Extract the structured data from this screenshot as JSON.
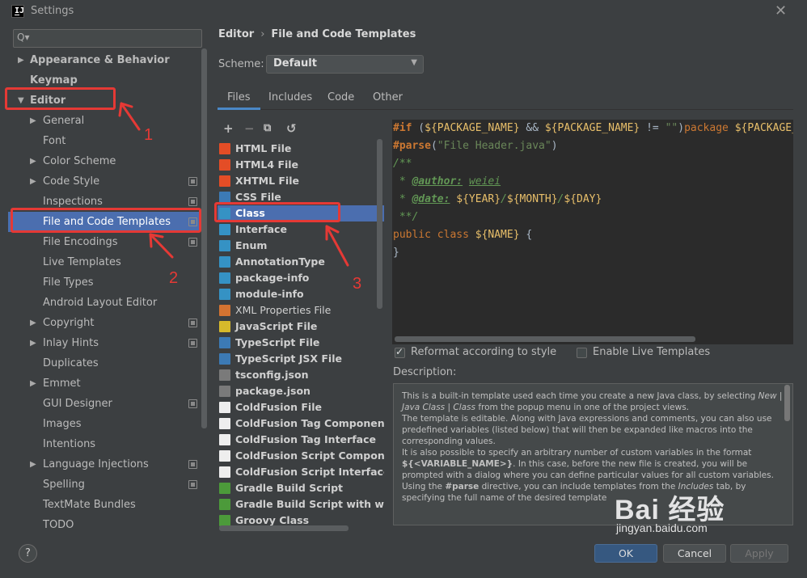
{
  "window": {
    "title": "Settings"
  },
  "search": {
    "placeholder": "Q▾"
  },
  "tree": [
    {
      "label": "Appearance & Behavior",
      "level": 0,
      "expanded": false,
      "bold": true
    },
    {
      "label": "Keymap",
      "level": 0,
      "bold": true
    },
    {
      "label": "Editor",
      "level": 0,
      "expanded": true,
      "bold": true
    },
    {
      "label": "General",
      "level": 1,
      "arrow": true
    },
    {
      "label": "Font",
      "level": 1
    },
    {
      "label": "Color Scheme",
      "level": 1,
      "arrow": true
    },
    {
      "label": "Code Style",
      "level": 1,
      "arrow": true,
      "badge": true
    },
    {
      "label": "Inspections",
      "level": 1,
      "badge": true
    },
    {
      "label": "File and Code Templates",
      "level": 1,
      "badge": true,
      "selected": true
    },
    {
      "label": "File Encodings",
      "level": 1,
      "badge": true
    },
    {
      "label": "Live Templates",
      "level": 1
    },
    {
      "label": "File Types",
      "level": 1
    },
    {
      "label": "Android Layout Editor",
      "level": 1
    },
    {
      "label": "Copyright",
      "level": 1,
      "arrow": true,
      "badge": true
    },
    {
      "label": "Inlay Hints",
      "level": 1,
      "arrow": true,
      "badge": true
    },
    {
      "label": "Duplicates",
      "level": 1
    },
    {
      "label": "Emmet",
      "level": 1,
      "arrow": true
    },
    {
      "label": "GUI Designer",
      "level": 1,
      "badge": true
    },
    {
      "label": "Images",
      "level": 1
    },
    {
      "label": "Intentions",
      "level": 1
    },
    {
      "label": "Language Injections",
      "level": 1,
      "arrow": true,
      "badge": true
    },
    {
      "label": "Spelling",
      "level": 1,
      "badge": true
    },
    {
      "label": "TextMate Bundles",
      "level": 1
    },
    {
      "label": "TODO",
      "level": 1
    }
  ],
  "annotations": {
    "n1": "1",
    "n2": "2",
    "n3": "3"
  },
  "breadcrumb": {
    "parent": "Editor",
    "sep": "›",
    "current": "File and Code Templates"
  },
  "scheme": {
    "label": "Scheme:",
    "value": "Default"
  },
  "tabs": [
    {
      "label": "Files",
      "active": true
    },
    {
      "label": "Includes"
    },
    {
      "label": "Code"
    },
    {
      "label": "Other"
    }
  ],
  "toolbar": {
    "add": "+",
    "remove": "−",
    "copy": "⧉",
    "reset": "↺"
  },
  "files": [
    {
      "label": "HTML File",
      "icon": "html-file-icon",
      "color": "#e44d26",
      "bold": true
    },
    {
      "label": "HTML4 File",
      "icon": "html-file-icon",
      "color": "#e44d26",
      "bold": true
    },
    {
      "label": "XHTML File",
      "icon": "html-file-icon",
      "color": "#e44d26",
      "bold": true
    },
    {
      "label": "CSS File",
      "icon": "css-file-icon",
      "color": "#3c7ab5",
      "bold": true
    },
    {
      "label": "Class",
      "icon": "java-class-icon",
      "color": "#3592c4",
      "bold": true,
      "selected": true
    },
    {
      "label": "Interface",
      "icon": "java-interface-icon",
      "color": "#3592c4",
      "bold": true
    },
    {
      "label": "Enum",
      "icon": "java-enum-icon",
      "color": "#3592c4",
      "bold": true
    },
    {
      "label": "AnnotationType",
      "icon": "java-annotation-icon",
      "color": "#3592c4",
      "bold": true
    },
    {
      "label": "package-info",
      "icon": "java-file-icon",
      "color": "#3592c4",
      "bold": true
    },
    {
      "label": "module-info",
      "icon": "java-file-icon",
      "color": "#3592c4",
      "bold": true
    },
    {
      "label": "XML Properties File",
      "icon": "xml-file-icon",
      "color": "#d47331",
      "bold": false
    },
    {
      "label": "JavaScript File",
      "icon": "javascript-file-icon",
      "color": "#d7ba2b",
      "bold": true
    },
    {
      "label": "TypeScript File",
      "icon": "typescript-file-icon",
      "color": "#3c7ab5",
      "bold": true
    },
    {
      "label": "TypeScript JSX File",
      "icon": "typescript-file-icon",
      "color": "#3c7ab5",
      "bold": true
    },
    {
      "label": "tsconfig.json",
      "icon": "json-file-icon",
      "color": "#7a7a7a",
      "bold": true
    },
    {
      "label": "package.json",
      "icon": "json-file-icon",
      "color": "#7a7a7a",
      "bold": true
    },
    {
      "label": "ColdFusion File",
      "icon": "coldfusion-file-icon",
      "color": "#eeeeee",
      "bold": true
    },
    {
      "label": "ColdFusion Tag Component",
      "icon": "coldfusion-file-icon",
      "color": "#eeeeee",
      "bold": true
    },
    {
      "label": "ColdFusion Tag Interface",
      "icon": "coldfusion-file-icon",
      "color": "#eeeeee",
      "bold": true
    },
    {
      "label": "ColdFusion Script Component",
      "icon": "coldfusion-file-icon",
      "color": "#eeeeee",
      "bold": true
    },
    {
      "label": "ColdFusion Script Interface",
      "icon": "coldfusion-file-icon",
      "color": "#eeeeee",
      "bold": true
    },
    {
      "label": "Gradle Build Script",
      "icon": "gradle-icon",
      "color": "#4c9a3a",
      "bold": true
    },
    {
      "label": "Gradle Build Script with wrapp",
      "icon": "gradle-icon",
      "color": "#4c9a3a",
      "bold": true
    },
    {
      "label": "Groovy Class",
      "icon": "groovy-icon",
      "color": "#4c9a3a",
      "bold": true
    }
  ],
  "code": {
    "line1": {
      "if": "#if",
      "p1": " (",
      "v1": "${PACKAGE_NAME}",
      "and": " && ",
      "v2": "${PACKAGE_NAME}",
      "ne": " != ",
      "s": "\"\"",
      "p2": ")",
      "pkg": "package ",
      "v3": "${PACKAGE_NAME}"
    },
    "line2": {
      "parse": "#parse",
      "p1": "(",
      "s": "\"File Header.java\"",
      "p2": ")"
    },
    "line3": "/**",
    "line4": {
      "star": " * ",
      "tag": "@author:",
      "sp": " ",
      "val": "weiei"
    },
    "line5": {
      "star": " * ",
      "tag": "@date:",
      "sp": " ",
      "y": "${YEAR}",
      "s1": "/",
      "m": "${MONTH}",
      "s2": "/",
      "d": "${DAY}"
    },
    "line6": " **/",
    "line7": {
      "kw": "public class ",
      "v": "${NAME}",
      "rest": " {"
    },
    "line8": "}"
  },
  "options": {
    "reformat": "Reformat according to style",
    "live": "Enable Live Templates"
  },
  "description": {
    "label": "Description:",
    "p1a": "This is a built-in template used each time you create a new Java class, by selecting ",
    "p1b": "New",
    "p1c": " | ",
    "p1d": "Java Class",
    "p1e": " | ",
    "p1f": "Class",
    "p1g": " from the popup menu in one of the project views.",
    "p2": "The template is editable. Along with Java expressions and comments, you can also use predefined variables (listed below) that will then be expanded like macros into the corresponding values.",
    "p3a": "It is also possible to specify an arbitrary number of custom variables in the format ",
    "p3b": "${<VARIABLE_NAME>}",
    "p3c": ". In this case, before the new file is created, you will be prompted with a dialog where you can define particular values for all custom variables.",
    "p4a": "Using the ",
    "p4b": "#parse",
    "p4c": " directive, you can include templates from the ",
    "p4d": "Includes",
    "p4e": " tab, by specifying the full name of the desired template"
  },
  "buttons": {
    "help": "?",
    "ok": "OK",
    "cancel": "Cancel",
    "apply": "Apply"
  },
  "watermark": {
    "brand": "Bai 经验",
    "url": "jingyan.baidu.com"
  },
  "colors": {
    "selection": "#4b6eaf",
    "annotation": "#e53935",
    "background": "#3c3f41",
    "editor": "#2b2b2b"
  }
}
